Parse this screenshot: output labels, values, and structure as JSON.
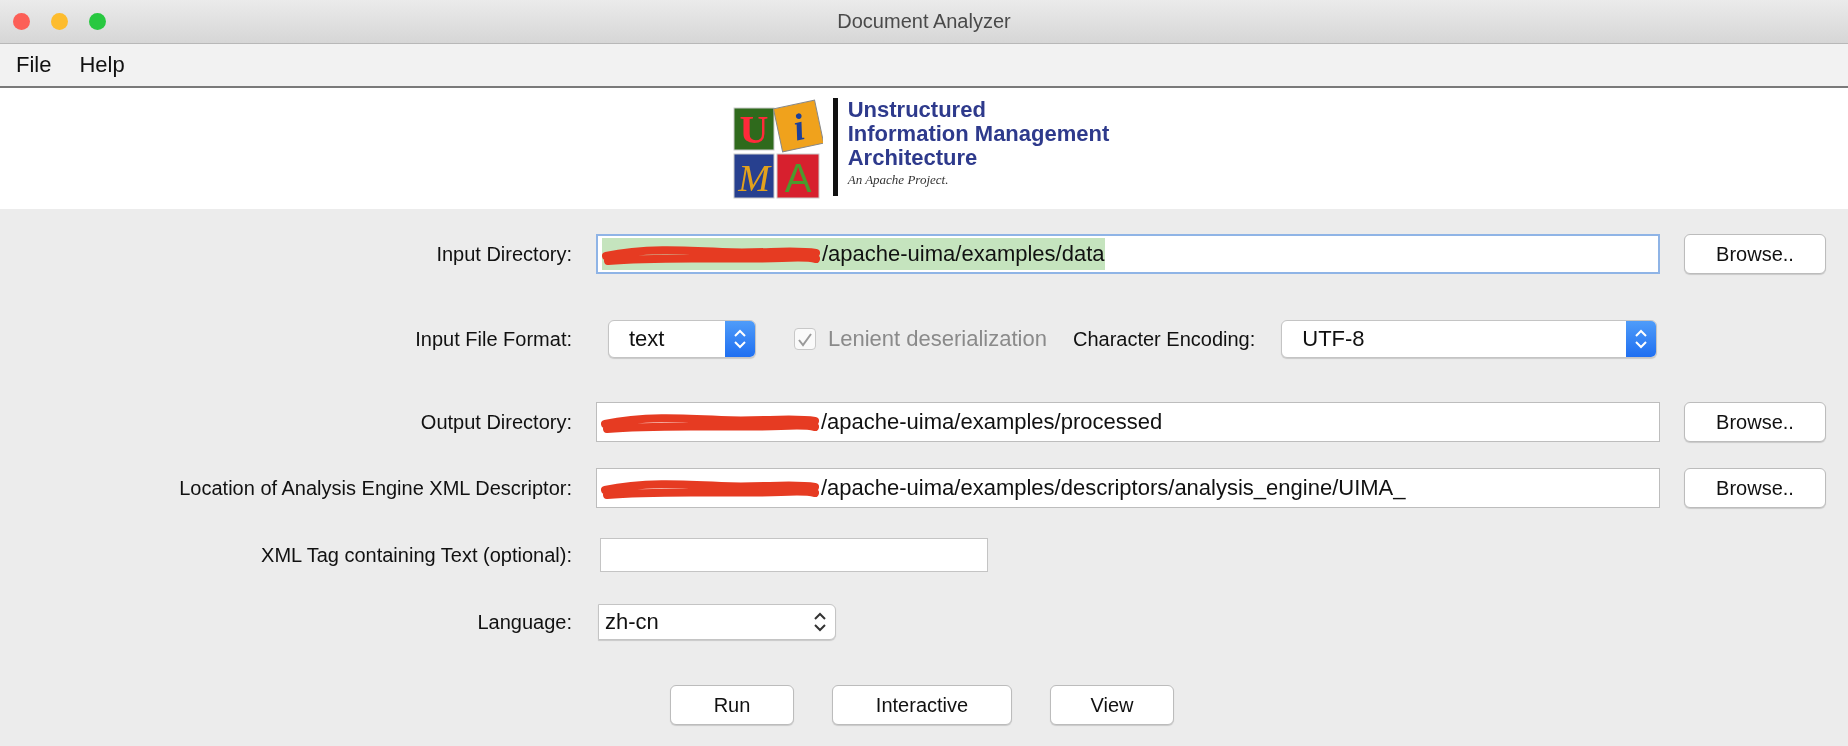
{
  "window": {
    "title": "Document Analyzer"
  },
  "menu": [
    {
      "label": "File"
    },
    {
      "label": "Help"
    }
  ],
  "logo": {
    "letters": [
      "U",
      "i",
      "M",
      "A"
    ],
    "lines": [
      "Unstructured",
      "Information Management",
      "Architecture"
    ],
    "tagline": "An Apache Project."
  },
  "form": {
    "input_directory": {
      "label": "Input Directory:",
      "value": "/apache-uima/examples/data",
      "redacted": true,
      "focused": true,
      "text_selected": true,
      "button": "Browse.."
    },
    "input_file_format": {
      "label": "Input File Format:",
      "value": "text"
    },
    "lenient": {
      "label": "Lenient deserialization",
      "checked": true,
      "disabled": true
    },
    "encoding": {
      "label": "Character Encoding:",
      "value": "UTF-8"
    },
    "output_directory": {
      "label": "Output Directory:",
      "value": "/apache-uima/examples/processed",
      "redacted": true,
      "focused": false,
      "text_selected": false,
      "button": "Browse.."
    },
    "descriptor": {
      "label": "Location of Analysis Engine XML Descriptor:",
      "value": "/apache-uima/examples/descriptors/analysis_engine/UIMA_",
      "redacted": true,
      "focused": false,
      "text_selected": false,
      "button": "Browse.."
    },
    "xml_tag": {
      "label": "XML Tag containing Text (optional):"
    },
    "language": {
      "label": "Language:",
      "value": "zh-cn"
    }
  },
  "buttons": [
    "Run",
    "Interactive",
    "View"
  ]
}
